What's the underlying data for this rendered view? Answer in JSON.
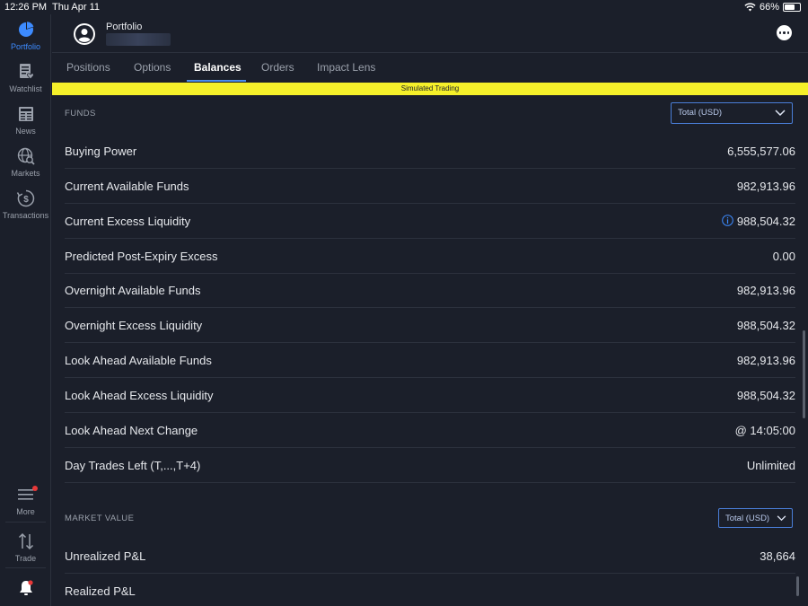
{
  "status_bar": {
    "time": "12:26 PM",
    "date": "Thu Apr 11",
    "battery": "66%",
    "battery_level": 0.66
  },
  "sidebar": {
    "items": [
      {
        "label": "Portfolio",
        "icon": "pie-chart-icon",
        "active": true
      },
      {
        "label": "Watchlist",
        "icon": "watchlist-icon"
      },
      {
        "label": "News",
        "icon": "newspaper-icon"
      },
      {
        "label": "Markets",
        "icon": "globe-search-icon"
      },
      {
        "label": "Transactions",
        "icon": "dollar-clock-icon"
      }
    ],
    "bottom_items": [
      {
        "label": "More",
        "icon": "menu-icon"
      },
      {
        "label": "Trade",
        "icon": "up-down-arrows-icon"
      },
      {
        "label": "",
        "icon": "bell-icon"
      }
    ]
  },
  "header": {
    "title": "Portfolio"
  },
  "tabs": [
    {
      "label": "Positions"
    },
    {
      "label": "Options"
    },
    {
      "label": "Balances",
      "active": true
    },
    {
      "label": "Orders"
    },
    {
      "label": "Impact Lens"
    }
  ],
  "banner": {
    "text": "Simulated Trading"
  },
  "funds": {
    "section_label": "FUNDS",
    "dropdown_value": "Total (USD)",
    "rows": [
      {
        "label": "Buying Power",
        "value": "6,555,577.06"
      },
      {
        "label": "Current Available Funds",
        "value": "982,913.96"
      },
      {
        "label": "Current Excess Liquidity",
        "value": "988,504.32"
      },
      {
        "label": "Predicted Post-Expiry Excess",
        "value": "0.00"
      },
      {
        "label": "Overnight Available Funds",
        "value": "982,913.96"
      },
      {
        "label": "Overnight Excess Liquidity",
        "value": "988,504.32"
      },
      {
        "label": "Look Ahead Available Funds",
        "value": "982,913.96"
      },
      {
        "label": "Look Ahead Excess Liquidity",
        "value": "988,504.32"
      },
      {
        "label": "Look Ahead Next Change",
        "value": "@ 14:05:00"
      },
      {
        "label": "Day Trades Left (T,...,T+4)",
        "value": "Unlimited"
      }
    ]
  },
  "market_value": {
    "section_label": "MARKET VALUE",
    "dropdown_value": "Total (USD)",
    "rows": [
      {
        "label": "Unrealized P&L",
        "value": "38,664"
      },
      {
        "label": "Realized P&L",
        "value": ""
      }
    ]
  },
  "colors": {
    "accent": "#3d8bff",
    "banner": "#f5f02a",
    "background": "#1b1f2a",
    "alert_dot": "#e83838"
  }
}
